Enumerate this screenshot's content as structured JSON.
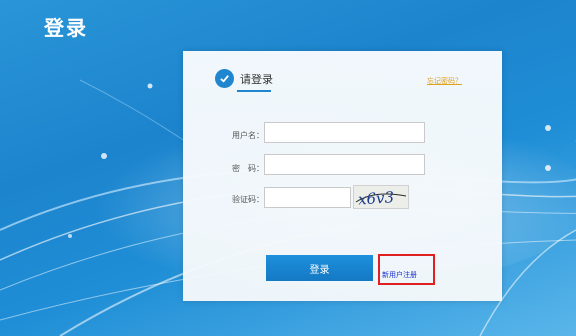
{
  "page": {
    "title": "登录"
  },
  "panel": {
    "heading": "请登录",
    "forgot_password": "忘记密码？"
  },
  "form": {
    "username_label": "用户名：",
    "password_label": "密　码：",
    "captcha_label": "验证码：",
    "captcha_text": "x6v3",
    "login_button": "登录",
    "register_link": "新用户注册"
  },
  "colors": {
    "accent": "#1f86cf",
    "button": "#1a84cf",
    "link_orange": "#e0a020",
    "highlight_red": "#e02020"
  }
}
